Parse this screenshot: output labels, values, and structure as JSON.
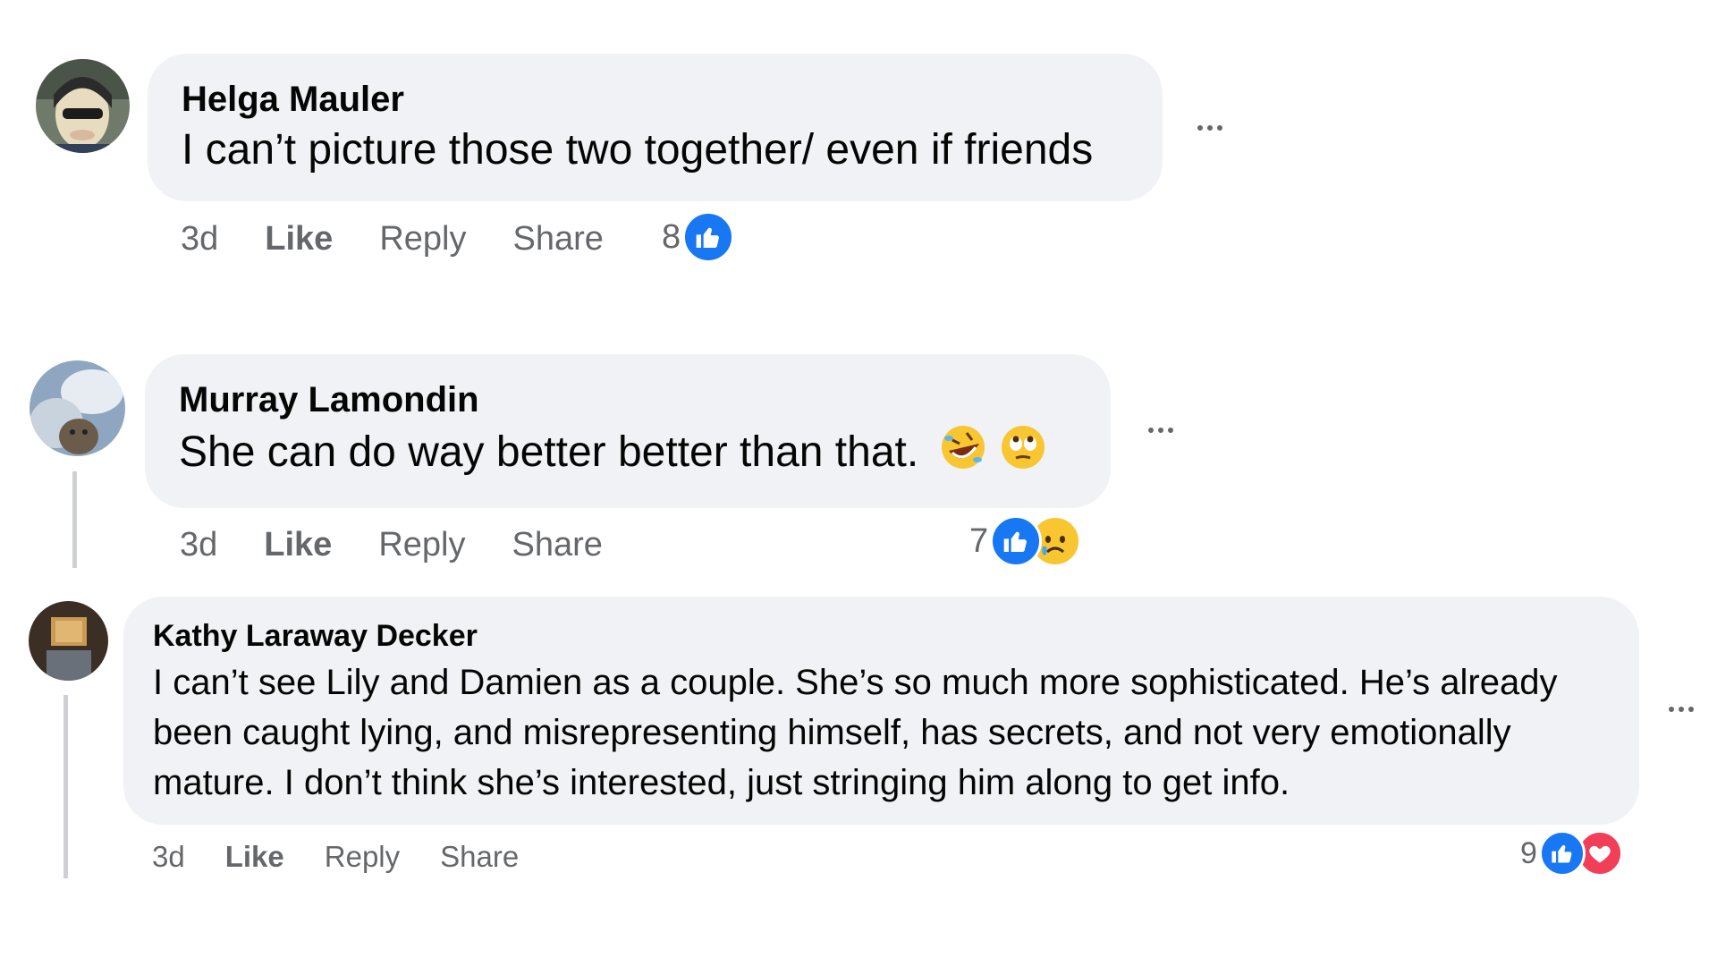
{
  "comments": [
    {
      "author": "Helga Mauler",
      "text": "I can’t picture those two together/ even if friends",
      "time": "3d",
      "like": "Like",
      "reply": "Reply",
      "share": "Share",
      "reaction_count": "8",
      "reactions": [
        "like-icon"
      ]
    },
    {
      "author": "Murray Lamondin",
      "text": "She can do way better better than that.",
      "emojis": [
        "rolling-on-floor-laughing-emoji",
        "face-with-rolling-eyes-emoji"
      ],
      "time": "3d",
      "like": "Like",
      "reply": "Reply",
      "share": "Share",
      "reaction_count": "7",
      "reactions": [
        "like-icon",
        "sad-icon"
      ]
    },
    {
      "author": "Kathy Laraway Decker",
      "text_lines": [
        "I can’t see Lily and Damien as a couple. She’s so much more sophisticated. He’s already",
        "been caught lying, and misrepresenting himself, has secrets, and not very emotionally",
        "mature. I don’t think she’s interested, just stringing him along to get info."
      ],
      "time": "3d",
      "like": "Like",
      "reply": "Reply",
      "share": "Share",
      "reaction_count": "9",
      "reactions": [
        "like-icon",
        "love-icon"
      ]
    }
  ],
  "colors": {
    "bubble": "#f0f2f5",
    "secondary_text": "#65676b",
    "like_blue": "#1877f2",
    "love_red": "#f33e58",
    "thread_line": "#ced0d4"
  }
}
